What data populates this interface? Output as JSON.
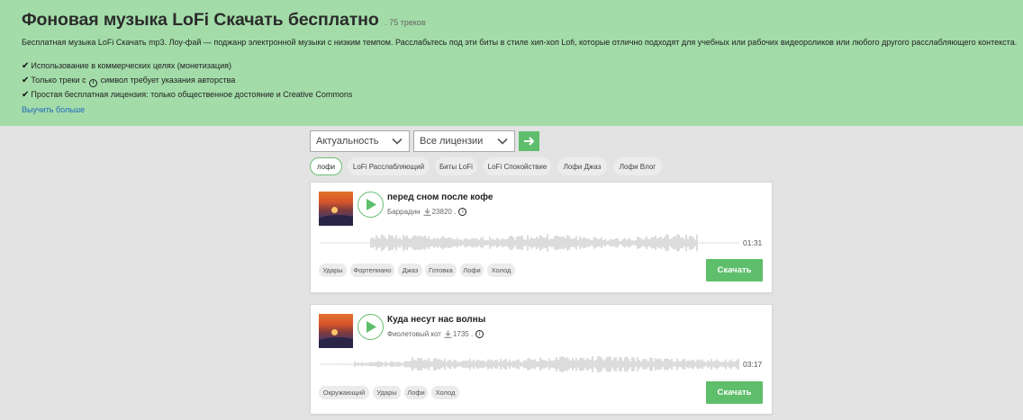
{
  "hero": {
    "title": "Фоновая музыка LoFi Скачать бесплатно",
    "count": ". 75 треков",
    "description": "Бесплатная музыка LoFi Скачать mp3. Лоу-фай — поджанр электронной музыки с низким темпом. Расслабьтесь под эти биты в стиле хип-хоп Lofi, которые отлично подходят для учебных или рабочих видеороликов или любого другого расслабляющего контекста.",
    "features": [
      {
        "text": "Использование в коммерческих целях (монетизация)"
      },
      {
        "pre": "Только треки с",
        "post": "символ требует указания авторства"
      },
      {
        "text": "Простая бесплатная лицензия: только общественное достояние и Creative Commons"
      }
    ],
    "learn_more": "Выучить больше"
  },
  "filters": {
    "sort_value": "Актуальность",
    "license_value": "Все лицензии"
  },
  "chips": [
    {
      "label": "лофи",
      "active": true
    },
    {
      "label": "LoFi Расслабляющий"
    },
    {
      "label": "Биты LoFi"
    },
    {
      "label": "LoFi Спокойствие"
    },
    {
      "label": "Лофи Джаз"
    },
    {
      "label": "Лофи Влог"
    }
  ],
  "tracks": [
    {
      "title": "перед сном после кофе",
      "author": "Баррадин",
      "downloads": "23820",
      "sep": ".",
      "duration": "01:31",
      "tags": [
        "Удары",
        "Фортепиано",
        "Джаз",
        "Готовка",
        "Лофи",
        "Холод"
      ],
      "download_label": "Скачать"
    },
    {
      "title": "Куда несут нас волны",
      "author": "Фиолетовый кот",
      "downloads": "1735",
      "sep": ".",
      "duration": "03:17",
      "tags": [
        "Окружающий",
        "Удары",
        "Лофи",
        "Холод"
      ],
      "download_label": "Скачать"
    }
  ],
  "colors": {
    "hero_bg": "#a3dca9",
    "accent": "#5fbe6b",
    "link": "#2368b8",
    "wave": "#b9b9b9"
  },
  "icons": [
    "check-icon",
    "cc-by-icon",
    "chevron-down-icon",
    "arrow-right-icon",
    "play-icon",
    "download-count-icon"
  ]
}
